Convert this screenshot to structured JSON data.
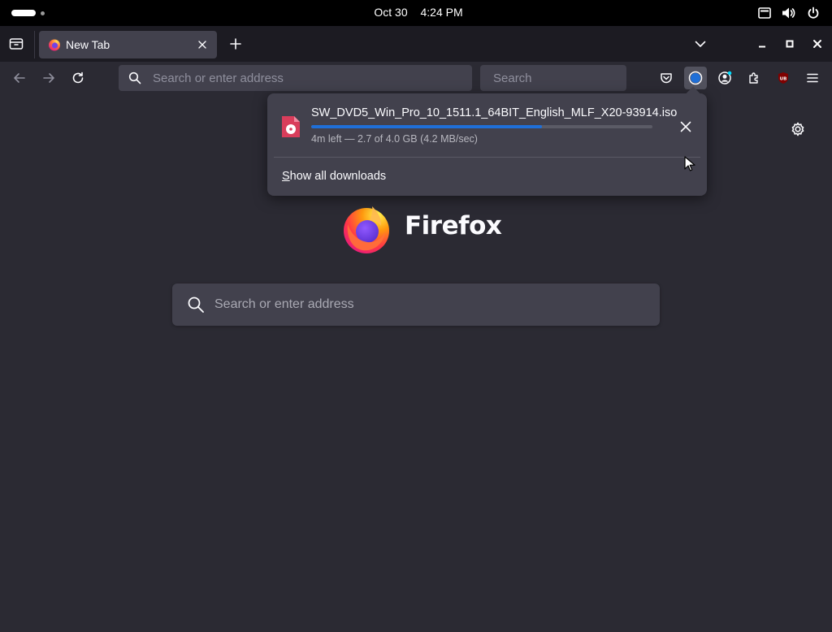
{
  "topbar": {
    "date": "Oct 30",
    "time": "4:24 PM",
    "tray_icons": [
      "keyboard-icon",
      "volume-icon",
      "power-icon"
    ]
  },
  "tabbar": {
    "tabs": [
      {
        "title": "New Tab",
        "favicon": "firefox-icon"
      }
    ]
  },
  "navbar": {
    "url_placeholder": "Search or enter address",
    "search_placeholder": "Search"
  },
  "newtab": {
    "brand": "Firefox",
    "search_placeholder": "Search or enter address"
  },
  "downloads": {
    "items": [
      {
        "filename": "SW_DVD5_Win_Pro_10_1511.1_64BIT_English_MLF_X20-93914.iso",
        "progress": 0.675,
        "status": "4m left — 2.7 of 4.0 GB (4.2 MB/sec)"
      }
    ],
    "show_all_access_key": "S",
    "show_all_rest": "how all downloads"
  },
  "colors": {
    "toolbar": "#2b2a33",
    "tabstrip": "#1c1b22",
    "field": "#42414d",
    "progress": "#1f6fd8"
  }
}
